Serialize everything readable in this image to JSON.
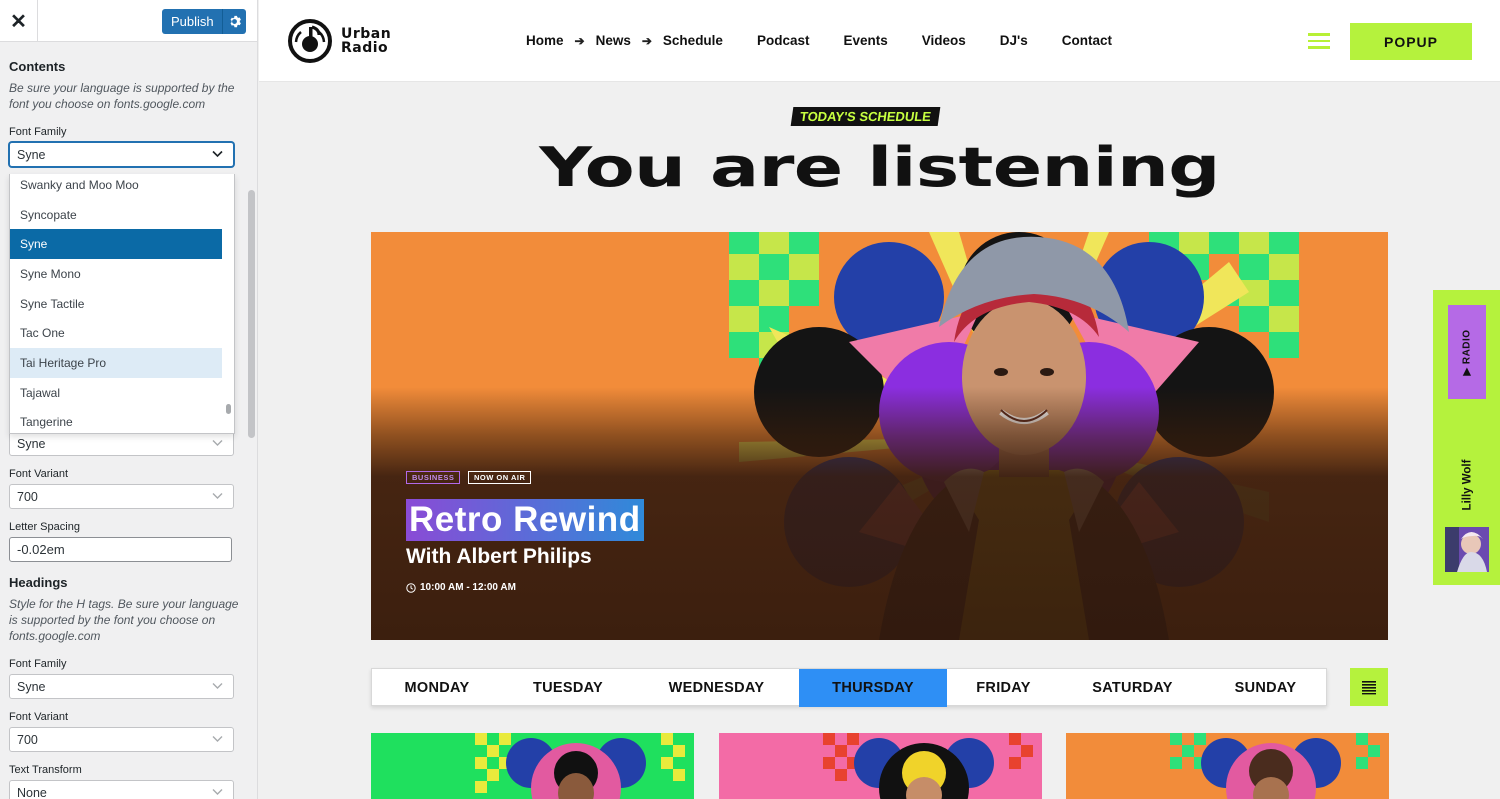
{
  "sidebar": {
    "publish_label": "Publish",
    "contents_heading": "Contents",
    "contents_desc": "Be sure your language is supported by the font you choose on fonts.google.com",
    "font_family_label": "Font Family",
    "font_family_value": "Syne",
    "dropdown_options": [
      "Swanky and Moo Moo",
      "Syncopate",
      "Syne",
      "Syne Mono",
      "Syne Tactile",
      "Tac One",
      "Tai Heritage Pro",
      "Tajawal",
      "Tangerine"
    ],
    "hidden_select_value": "Syne",
    "font_variant_label": "Font Variant",
    "font_variant_value": "700",
    "letter_spacing_label": "Letter Spacing",
    "letter_spacing_value": "-0.02em",
    "headings_heading": "Headings",
    "headings_desc": "Style for the H tags. Be sure your language is supported by the font you choose on fonts.google.com",
    "headings_font_family_label": "Font Family",
    "headings_font_family_value": "Syne",
    "headings_font_variant_label": "Font Variant",
    "headings_font_variant_value": "700",
    "text_transform_label": "Text Transform",
    "text_transform_value": "None"
  },
  "site": {
    "logo_line1": "Urban",
    "logo_line2": "Radio",
    "nav": [
      "Home",
      "News",
      "Schedule",
      "Podcast",
      "Events",
      "Videos",
      "DJ's",
      "Contact"
    ],
    "popup_label": "POPUP",
    "today_badge": "TODAY'S SCHEDULE",
    "headline": "You are listening",
    "hero": {
      "tag_category": "BUSINESS",
      "tag_status": "NOW ON AIR",
      "title": "Retro Rewind",
      "host": "With Albert Philips",
      "time": "10:00 AM - 12:00 AM"
    },
    "days": [
      "MONDAY",
      "TUESDAY",
      "WEDNESDAY",
      "THURSDAY",
      "FRIDAY",
      "SATURDAY",
      "SUNDAY"
    ],
    "active_day": "THURSDAY",
    "side_player": {
      "radio_label": "▶ RADIO",
      "dj_name": "Lilly Wolf"
    }
  },
  "colors": {
    "accent_green": "#b5f23d",
    "accent_purple": "#b56ae6",
    "active_day_blue": "#2e8ff5",
    "publish_blue": "#2271b1",
    "hero_orange": "#f28c3a"
  },
  "icons": [
    "close-icon",
    "gear-icon",
    "chevron-down-icon",
    "arrow-right-icon",
    "hamburger-icon",
    "clock-icon",
    "list-icon",
    "radio-logo-icon"
  ]
}
